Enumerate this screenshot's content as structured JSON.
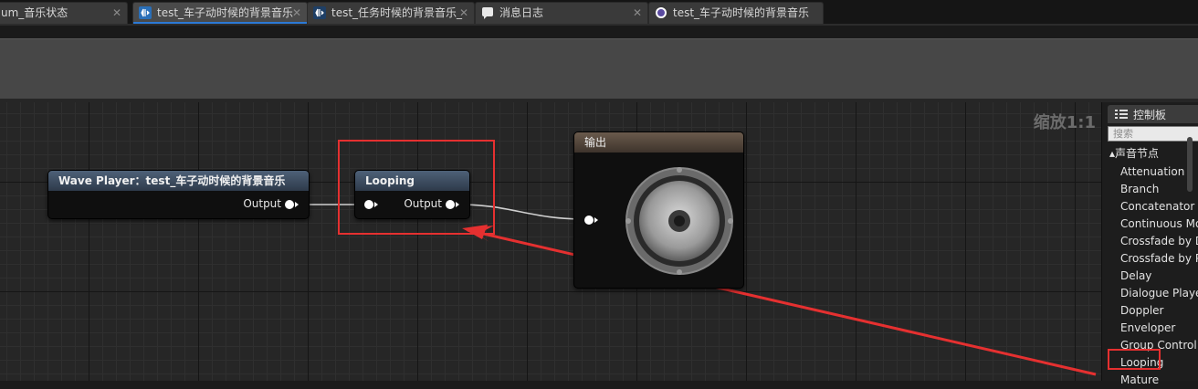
{
  "tabs": [
    {
      "label": "um_音乐状态",
      "icon": "none"
    },
    {
      "label": "test_车子动时候的背景音乐",
      "icon": "sound-cue-icon",
      "active": true
    },
    {
      "label": "test_任务时候的背景音乐_",
      "icon": "sound-cue-icon"
    },
    {
      "label": "消息日志",
      "icon": "message-log-icon"
    },
    {
      "label": "test_车子动时候的背景音乐",
      "icon": "circle-icon"
    }
  ],
  "tab_close_glyph": "✕",
  "graph": {
    "zoom_label": "缩放1:1",
    "nodes": {
      "wave_player": {
        "title": "Wave Player：test_车子动时候的背景音乐",
        "output_label": "Output"
      },
      "looping": {
        "title": "Looping",
        "output_label": "Output"
      },
      "output": {
        "title": "输出"
      }
    }
  },
  "palette": {
    "title": "控制板",
    "search_placeholder": "搜索",
    "category": "▴声音节点",
    "items": [
      "Attenuation",
      "Branch",
      "Concatenator",
      "Continuous Mo",
      "Crossfade by D",
      "Crossfade by P",
      "Delay",
      "Dialogue Playe",
      "Doppler",
      "Enveloper",
      "Group Control",
      "Looping",
      "Mature"
    ]
  },
  "colors": {
    "annotation_red": "#e53030",
    "accent_blue": "#2c7ad6"
  }
}
